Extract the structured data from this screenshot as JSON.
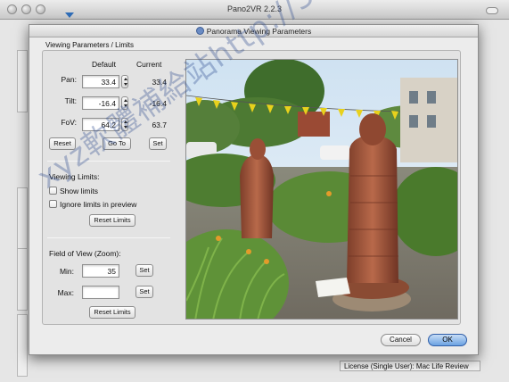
{
  "main_window": {
    "title": "Pano2VR 2.2.3"
  },
  "dialog": {
    "title": "Panorama Viewing Parameters",
    "group_label": "Viewing Parameters / Limits",
    "columns": {
      "default": "Default",
      "current": "Current"
    },
    "rows": [
      {
        "label": "Pan:",
        "default": "33.4",
        "current": "33.4"
      },
      {
        "label": "Tilt:",
        "default": "-16.4",
        "current": "-16.4"
      },
      {
        "label": "FoV:",
        "default": "64.2",
        "current": "63.7"
      }
    ],
    "buttons": {
      "reset": "Reset",
      "goto": "Go To",
      "set": "Set"
    },
    "viewing_limits": {
      "title": "Viewing Limits:",
      "show_limits": "Show limits",
      "ignore_limits": "Ignore limits in preview",
      "reset_limits": "Reset Limits"
    },
    "fov_zoom": {
      "title": "Field of View (Zoom):",
      "min_label": "Min:",
      "min_value": "35",
      "max_label": "Max:",
      "set_min": "Set",
      "set_max": "Set",
      "reset_limits": "Reset Limits"
    },
    "cancel": "Cancel",
    "ok": "OK"
  },
  "license": "License (Single User): Mac Life Review",
  "watermark": "xyz軟體補給站http://31.to",
  "colors": {
    "ok_button": "#6aa2e2",
    "sculpture": "#a4553a"
  }
}
